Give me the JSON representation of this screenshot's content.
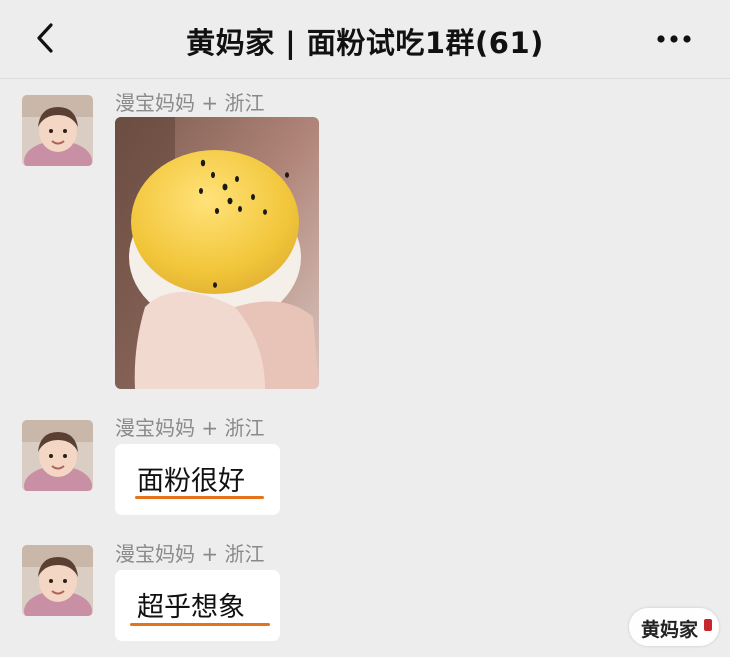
{
  "header": {
    "title": "黄妈家 | 面粉试吃1群(61)",
    "back_icon": "chevron-left-icon",
    "more_icon": "more-dots-icon"
  },
  "messages": [
    {
      "sender": "漫宝妈妈 + 浙江",
      "type": "image",
      "image": "egg-yolk-pastry-photo"
    },
    {
      "sender": "漫宝妈妈 + 浙江",
      "type": "text",
      "text": "面粉很好"
    },
    {
      "sender": "漫宝妈妈 + 浙江",
      "type": "text",
      "text": "超乎想象"
    }
  ],
  "watermark": {
    "text": "黄妈家"
  },
  "colors": {
    "background": "#ededed",
    "bubble": "#ffffff",
    "underline": "#e5731b",
    "sender": "#8a8a8a",
    "seal": "#c8262d"
  }
}
